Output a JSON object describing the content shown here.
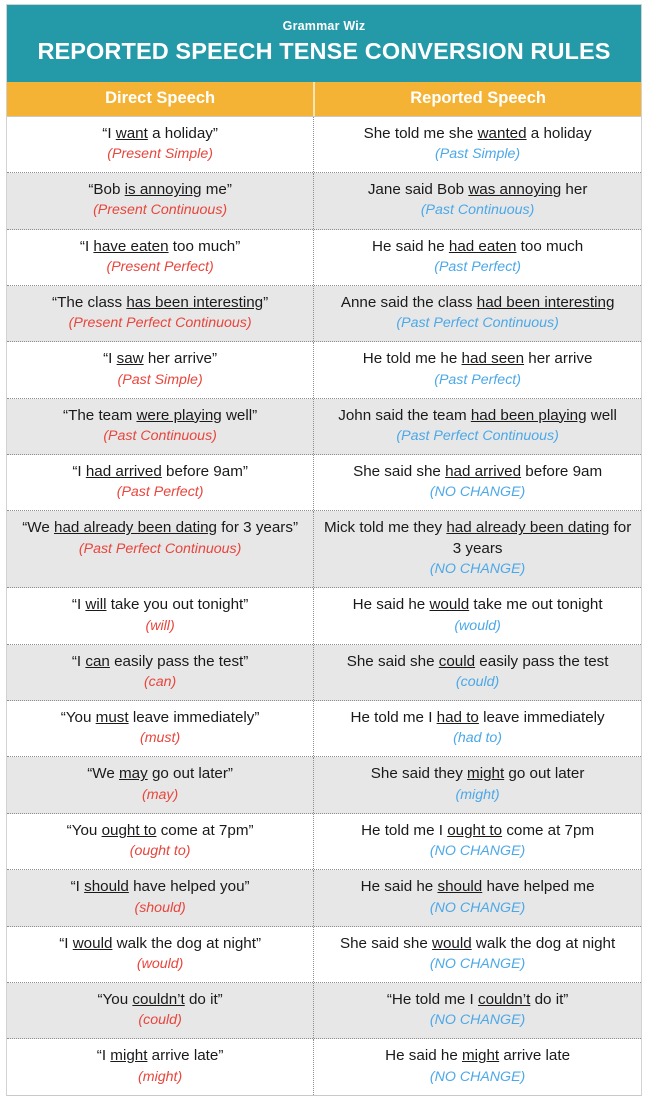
{
  "header": {
    "brand": "Grammar Wiz",
    "title": "REPORTED SPEECH TENSE CONVERSION RULES",
    "banner_color": "#2499a8"
  },
  "table": {
    "band_color": "#f5b335",
    "direct_tag_color": "#e8453c",
    "reported_tag_color": "#4ba8e8",
    "columns": {
      "direct": "Direct Speech",
      "reported": "Reported Speech"
    },
    "rows": [
      {
        "direct_html": "“I <u>want</u> a holiday”",
        "direct_tag": "(Present Simple)",
        "reported_html": "She told me she <u>wanted</u> a holiday",
        "reported_tag": "(Past Simple)"
      },
      {
        "direct_html": "“Bob <u>is annoying</u> me”",
        "direct_tag": "(Present Continuous)",
        "reported_html": "Jane said Bob <u>was annoying</u> her",
        "reported_tag": "(Past Continuous)"
      },
      {
        "direct_html": "“I <u>have eaten</u> too much”",
        "direct_tag": "(Present Perfect)",
        "reported_html": "He said he <u>had eaten</u> too much",
        "reported_tag": "(Past Perfect)"
      },
      {
        "direct_html": "“The class <u>has been interesting</u>”",
        "direct_tag": "(Present Perfect Continuous)",
        "reported_html": "Anne said the class <u>had been interesting</u>",
        "reported_tag": "(Past Perfect Continuous)"
      },
      {
        "direct_html": "“I <u>saw</u> her arrive”",
        "direct_tag": "(Past Simple)",
        "reported_html": "He told me he <u>had seen</u> her arrive",
        "reported_tag": "(Past Perfect)"
      },
      {
        "direct_html": "“The team <u>were playing</u> well”",
        "direct_tag": "(Past Continuous)",
        "reported_html": "John said the team <u>had been playing</u> well",
        "reported_tag": "(Past Perfect Continuous)"
      },
      {
        "direct_html": "“I <u>had arrived</u> before 9am”",
        "direct_tag": "(Past Perfect)",
        "reported_html": "She said she <u>had arrived</u> before 9am",
        "reported_tag": "(NO CHANGE)"
      },
      {
        "direct_html": "“We <u>had already been dating</u> for 3 years”",
        "direct_tag": "(Past Perfect Continuous)",
        "reported_html": "Mick told me they <u>had already been dating</u> for 3 years",
        "reported_tag": "(NO CHANGE)"
      },
      {
        "direct_html": "“I <u>will</u> take you out tonight”",
        "direct_tag": "(will)",
        "reported_html": "He said he <u>would</u> take me out tonight",
        "reported_tag": "(would)"
      },
      {
        "direct_html": "“I <u>can</u> easily pass the test”",
        "direct_tag": "(can)",
        "reported_html": "She said she <u>could</u> easily pass the test",
        "reported_tag": "(could)"
      },
      {
        "direct_html": "“You <u>must</u> leave immediately”",
        "direct_tag": "(must)",
        "reported_html": "He told me I <u>had to</u> leave immediately",
        "reported_tag": "(had to)"
      },
      {
        "direct_html": "“We <u>may</u> go out later”",
        "direct_tag": "(may)",
        "reported_html": "She said they <u>might</u> go out later",
        "reported_tag": "(might)"
      },
      {
        "direct_html": "“You <u>ought to</u> come at 7pm”",
        "direct_tag": "(ought to)",
        "reported_html": "He told me I <u>ought to</u> come at 7pm",
        "reported_tag": "(NO CHANGE)"
      },
      {
        "direct_html": "“I <u>should</u> have helped you”",
        "direct_tag": "(should)",
        "reported_html": "He said he <u>should</u> have helped me",
        "reported_tag": "(NO CHANGE)"
      },
      {
        "direct_html": "“I <u>would</u> walk the dog at night”",
        "direct_tag": "(would)",
        "reported_html": "She said she <u>would</u> walk the dog at night",
        "reported_tag": "(NO CHANGE)"
      },
      {
        "direct_html": "“You <u>couldn’t</u> do it”",
        "direct_tag": "(could)",
        "reported_html": "“He told me I <u>couldn’t</u> do it”",
        "reported_tag": "(NO CHANGE)"
      },
      {
        "direct_html": "“I <u>might</u> arrive late”",
        "direct_tag": "(might)",
        "reported_html": "He said he <u>might</u> arrive late",
        "reported_tag": "(NO CHANGE)"
      }
    ]
  }
}
